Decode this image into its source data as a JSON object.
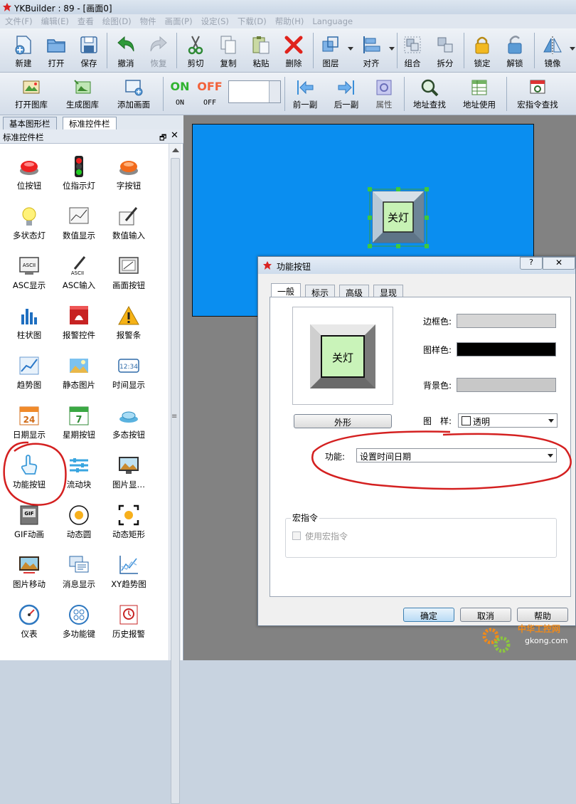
{
  "window": {
    "title": "YKBuilder : 89 - [画面0]"
  },
  "menu": [
    "文件(F)",
    "编辑(E)",
    "查看",
    "绘图(D)",
    "物件",
    "画面(P)",
    "设定(S)",
    "下载(D)",
    "帮助(H)",
    "Language"
  ],
  "toolbar1": [
    {
      "label": "新建",
      "icon": "new-file-icon"
    },
    {
      "label": "打开",
      "icon": "open-folder-icon"
    },
    {
      "label": "保存",
      "icon": "save-disk-icon"
    },
    {
      "label": "撤消",
      "icon": "undo-arrow-icon"
    },
    {
      "label": "恢复",
      "icon": "redo-arrow-icon"
    },
    {
      "label": "剪切",
      "icon": "scissors-icon"
    },
    {
      "label": "复制",
      "icon": "copy-icon"
    },
    {
      "label": "粘贴",
      "icon": "paste-icon"
    },
    {
      "label": "删除",
      "icon": "delete-x-icon"
    },
    {
      "label": "图层",
      "icon": "layers-icon"
    },
    {
      "label": "对齐",
      "icon": "align-icon"
    },
    {
      "label": "组合",
      "icon": "group-icon"
    },
    {
      "label": "拆分",
      "icon": "ungroup-icon"
    },
    {
      "label": "锁定",
      "icon": "lock-icon"
    },
    {
      "label": "解锁",
      "icon": "unlock-icon"
    },
    {
      "label": "镜像",
      "icon": "mirror-icon"
    }
  ],
  "toolbar2": [
    {
      "label": "打开图库",
      "icon": "open-library-icon"
    },
    {
      "label": "生成图库",
      "icon": "create-library-icon"
    },
    {
      "label": "添加画面",
      "icon": "add-screen-icon"
    },
    {
      "label": "ON",
      "icon": "on-text-icon",
      "glyph": "ON"
    },
    {
      "label": "OFF",
      "icon": "off-text-icon",
      "glyph": "OFF"
    },
    {
      "label": "前一副",
      "icon": "prev-arrow-icon"
    },
    {
      "label": "后一副",
      "icon": "next-arrow-icon"
    },
    {
      "label": "属性",
      "icon": "properties-icon"
    },
    {
      "label": "地址查找",
      "icon": "magnifier-icon"
    },
    {
      "label": "地址使用",
      "icon": "table-icon"
    },
    {
      "label": "宏指令查找",
      "icon": "macro-search-icon"
    }
  ],
  "left_tabs": [
    {
      "label": "基本图形栏"
    },
    {
      "label": "标准控件栏"
    }
  ],
  "panel": {
    "title": "标准控件栏",
    "pin": "🗗",
    "close": "✕"
  },
  "controls": [
    {
      "label": "位按钮",
      "icon": "red-button-icon"
    },
    {
      "label": "位指示灯",
      "icon": "traffic-light-icon"
    },
    {
      "label": "字按钮",
      "icon": "orange-button-icon"
    },
    {
      "label": "多状态灯",
      "icon": "bulb-icon"
    },
    {
      "label": "数值显示",
      "icon": "numeric-display-icon"
    },
    {
      "label": "数值输入",
      "icon": "numeric-input-icon"
    },
    {
      "label": "ASC显示",
      "icon": "ascii-display-icon",
      "glyph": "ASCII"
    },
    {
      "label": "ASC输入",
      "icon": "ascii-input-icon",
      "glyph": "ASCII"
    },
    {
      "label": "画面按钮",
      "icon": "screen-button-icon"
    },
    {
      "label": "柱状图",
      "icon": "bar-chart-icon"
    },
    {
      "label": "报警控件",
      "icon": "alarm-control-icon"
    },
    {
      "label": "报警条",
      "icon": "warning-triangle-icon"
    },
    {
      "label": "趋势图",
      "icon": "trend-chart-icon"
    },
    {
      "label": "静态图片",
      "icon": "static-picture-icon"
    },
    {
      "label": "时间显示",
      "icon": "time-display-icon",
      "glyph": "12:34"
    },
    {
      "label": "日期显示",
      "icon": "date-calendar-icon",
      "glyph": "24"
    },
    {
      "label": "星期按钮",
      "icon": "week-calendar-icon",
      "glyph": "7"
    },
    {
      "label": "多态按钮",
      "icon": "multistate-button-icon"
    },
    {
      "label": "功能按钮",
      "icon": "hand-pointer-icon"
    },
    {
      "label": "流动块",
      "icon": "flow-block-icon"
    },
    {
      "label": "图片显…",
      "icon": "picture-display-icon"
    },
    {
      "label": "GIF动画",
      "icon": "gif-animation-icon",
      "glyph": "GIF"
    },
    {
      "label": "动态圆",
      "icon": "dynamic-circle-icon"
    },
    {
      "label": "动态矩形",
      "icon": "dynamic-rect-icon"
    },
    {
      "label": "图片移动",
      "icon": "picture-move-icon"
    },
    {
      "label": "消息显示",
      "icon": "message-display-icon"
    },
    {
      "label": "XY趋势图",
      "icon": "xy-trend-icon"
    },
    {
      "label": "仪表",
      "icon": "gauge-icon"
    },
    {
      "label": "多功能键",
      "icon": "multifunction-key-icon"
    },
    {
      "label": "历史报警",
      "icon": "history-alarm-icon"
    }
  ],
  "canvas": {
    "button_text": "关灯",
    "bg_color": "#0a8ef0"
  },
  "dialog": {
    "title": "功能按钮",
    "help": "?",
    "close": "✕",
    "tabs": [
      {
        "label": "一般"
      },
      {
        "label": "标示"
      },
      {
        "label": "高级"
      },
      {
        "label": "显现"
      }
    ],
    "preview_text": "关灯",
    "border_color_label": "边框色:",
    "pattern_color_label": "图样色:",
    "bg_color_label": "背景色:",
    "colors": {
      "border": "#d6d6d6",
      "pattern": "#000000",
      "background": "#c8c8c8"
    },
    "shape_button": "外形",
    "pattern_label": "图　样:",
    "pattern_value": "透明",
    "function_label": "功能:",
    "function_value": "设置时间日期",
    "macro_group": "宏指令",
    "macro_checkbox": "使用宏指令",
    "ok": "确定",
    "cancel": "取消",
    "helpbtn": "帮助"
  },
  "watermark": {
    "cn": "中华工控网",
    "url": "gkong.com"
  }
}
